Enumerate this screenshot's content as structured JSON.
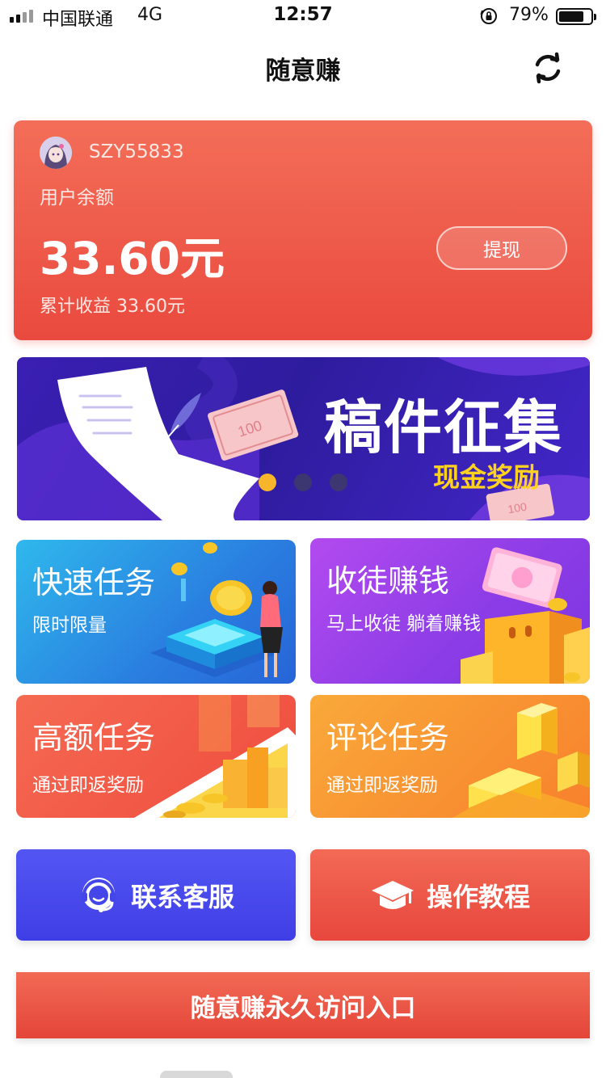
{
  "status_bar": {
    "carrier": "中国联通",
    "network": "4G",
    "time": "12:57",
    "battery_percent": "79%",
    "battery_level": 0.79
  },
  "nav": {
    "title": "随意赚",
    "refresh_icon": "refresh-icon"
  },
  "balance_card": {
    "username": "SZY55833",
    "balance_label": "用户余额",
    "balance_amount": "33.60元",
    "total_earnings": "累计收益 33.60元",
    "withdraw_label": "提现"
  },
  "banner": {
    "title": "稿件征集",
    "subtitle": "现金奖励",
    "note_text_1": "100",
    "note_text_2": "100",
    "active_index": 0,
    "dot_count": 3
  },
  "tiles": [
    {
      "title": "快速任务",
      "subtitle": "限时限量"
    },
    {
      "title": "收徒赚钱",
      "subtitle": "马上收徒 躺着赚钱"
    },
    {
      "title": "高额任务",
      "subtitle": "通过即返奖励"
    },
    {
      "title": "评论任务",
      "subtitle": "通过即返奖励"
    }
  ],
  "actions": {
    "service_label": "联系客服",
    "tutorial_label": "操作教程"
  },
  "entry": {
    "label": "随意赚永久访问入口"
  },
  "colors": {
    "card_red": "#ea4a3e",
    "banner_purple": "#2e1c9e",
    "banner_gold": "#ffd21f",
    "blue_button": "#4a4aee"
  }
}
